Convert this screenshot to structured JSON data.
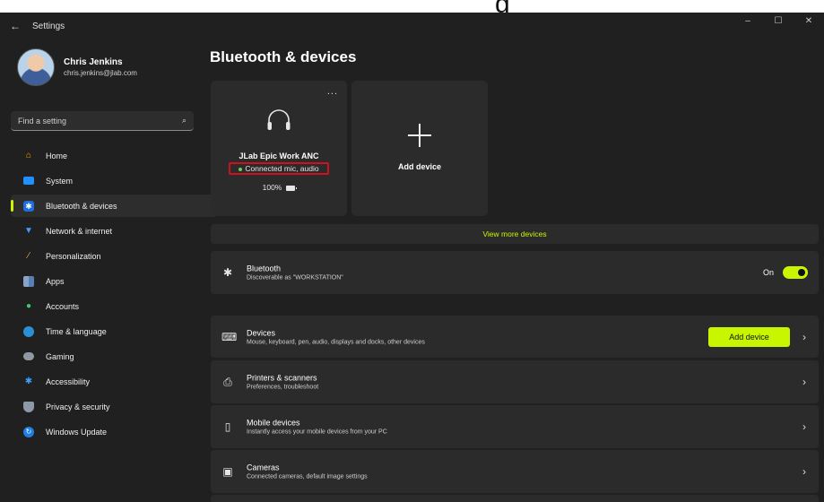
{
  "overlay_text": "g",
  "window": {
    "title": "Settings",
    "back": "←",
    "controls": [
      "–",
      "☐",
      "✕"
    ]
  },
  "profile": {
    "name": "Chris Jenkins",
    "email": "chris.jenkins@jlab.com"
  },
  "search": {
    "placeholder": "Find a setting"
  },
  "nav": {
    "items": [
      {
        "label": "Home",
        "icon": "home-icon"
      },
      {
        "label": "System",
        "icon": "system-icon"
      },
      {
        "label": "Bluetooth & devices",
        "icon": "bluetooth-icon",
        "active": true
      },
      {
        "label": "Network & internet",
        "icon": "wifi-icon"
      },
      {
        "label": "Personalization",
        "icon": "brush-icon"
      },
      {
        "label": "Apps",
        "icon": "apps-icon"
      },
      {
        "label": "Accounts",
        "icon": "person-icon"
      },
      {
        "label": "Time & language",
        "icon": "globe-icon"
      },
      {
        "label": "Gaming",
        "icon": "controller-icon"
      },
      {
        "label": "Accessibility",
        "icon": "accessibility-icon"
      },
      {
        "label": "Privacy & security",
        "icon": "shield-icon"
      },
      {
        "label": "Windows Update",
        "icon": "update-icon"
      }
    ]
  },
  "page": {
    "title": "Bluetooth & devices"
  },
  "device_card": {
    "more": "...",
    "name": "JLab Epic Work ANC",
    "status": "Connected mic, audio",
    "battery": "100%",
    "battery_level": 100
  },
  "add_card": {
    "label": "Add device"
  },
  "view_more": "View more devices",
  "bluetooth": {
    "title": "Bluetooth",
    "subtitle": "Discoverable as \"WORKSTATION\"",
    "state_label": "On",
    "on": true
  },
  "rows": {
    "devices": {
      "title": "Devices",
      "subtitle": "Mouse, keyboard, pen, audio, displays and docks, other devices",
      "button": "Add device"
    },
    "printers": {
      "title": "Printers & scanners",
      "subtitle": "Preferences, troubleshoot"
    },
    "mobile": {
      "title": "Mobile devices",
      "subtitle": "Instantly access your mobile devices from your PC"
    },
    "cameras": {
      "title": "Cameras",
      "subtitle": "Connected cameras, default image settings"
    }
  },
  "colors": {
    "accent": "#c8f500",
    "highlight_border": "#d0101c",
    "background": "#202020",
    "card": "#2b2b2b"
  }
}
